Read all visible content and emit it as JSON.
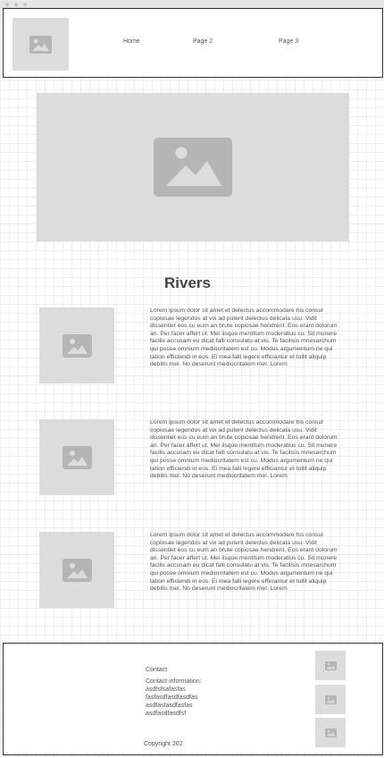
{
  "nav": {
    "items": [
      {
        "label": "Home"
      },
      {
        "label": "Page 2"
      },
      {
        "label": "Page 3"
      }
    ]
  },
  "main": {
    "title": "Rivers",
    "sections": [
      {
        "text": "Lorem ipsum dolor sit amet et delectus accommodare his consul copiosae legendos at vix ad putent delectus delicata usu. Vidit dissentiet eos cu eum an brute copiosae hendrerit. Eos erant dolorum an. Per facer affert ut. Mei iisque mentitum moderatius cu. Sit munere facilis accusam eu dicat falli consulatu at vis. Te facilisis mnesarchum qui posse omnium mediocritatem est cu. Modus argumentum ne qui tation efficiendi in eos. Ei mea falli legere efficiantur et tollit aliquip debitis mei. No deserunt mediocritatem mel. Lorem"
      },
      {
        "text": "Lorem ipsum dolor sit amet et delectus accommodare his consul copiosae legendos at vix ad putent delectus delicata usu. Vidit dissentiet eos cu eum an brute copiosae hendrerit. Eos erant dolorum an. Per facer affert ut. Mei iisque mentitum moderatius cu. Sit munere facilis accusam eu dicat falli consulatu at vis. Te facilisis mnesarchum qui posse omnium mediocritatem est cu. Modus argumentum ne qui tation efficiendi in eos. Ei mea falli legere efficiantur et tollit aliquip debitis mei. No deserunt mediocritatem mel. Lorem"
      },
      {
        "text": "Lorem ipsum dolor sit amet et delectus accommodare his consul copiosae legendos at vix ad putent delectus delicata usu. Vidit dissentiet eos cu eum an brute copiosae hendrerit. Eos erant dolorum an. Per facer affert ut. Mei iisque mentitum moderatius cu. Sit munere facilis accusam eu dicat falli consulatu at vis. Te facilisis mnesarchum qui posse omnium mediocritatem est cu. Modus argumentum ne qui tation efficiendi in eos. Ei mea falli legere efficiantur et tollit aliquip debitis mei. No deserunt mediocritatem mel. Lorem"
      }
    ]
  },
  "footer": {
    "contact_label": "Contact",
    "contact_info_label": "Contact information:",
    "contact_lines": [
      "asdfsfsafasfas",
      "fasfasdfasdfasdfas",
      "asdfasfasdfasfas",
      "asdfasdfasdfsf"
    ],
    "copyright": "Copyright 202"
  },
  "icons": {
    "logo": "image-placeholder-icon",
    "hero": "image-placeholder-icon",
    "section": "image-placeholder-icon",
    "social": "image-placeholder-icon"
  },
  "colors": {
    "placeholder_bg": "#dcdcdc",
    "placeholder_icon": "#b5b5b5",
    "border": "#333333",
    "text": "#555555"
  }
}
